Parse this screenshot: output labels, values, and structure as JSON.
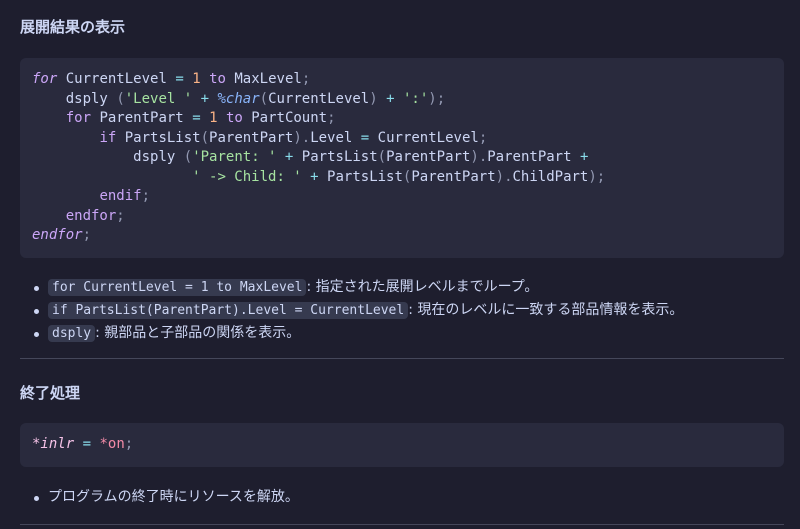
{
  "sections": {
    "display": {
      "heading": "展開結果の表示",
      "code_lines": [
        "for CurrentLevel = 1 to MaxLevel;",
        "    dsply ('Level ' + %char(CurrentLevel) + ':');",
        "    for ParentPart = 1 to PartCount;",
        "        if PartsList(ParentPart).Level = CurrentLevel;",
        "            dsply ('Parent: ' + PartsList(ParentPart).ParentPart +",
        "                   ' -> Child: ' + PartsList(ParentPart).ChildPart);",
        "        endif;",
        "    endfor;",
        "endfor;"
      ],
      "bullets": [
        {
          "code": "for CurrentLevel = 1 to MaxLevel",
          "text": ": 指定された展開レベルまでループ。"
        },
        {
          "code": "if PartsList(ParentPart).Level = CurrentLevel",
          "text": ": 現在のレベルに一致する部品情報を表示。"
        },
        {
          "code": "dsply",
          "text": ": 親部品と子部品の関係を表示。"
        }
      ]
    },
    "final": {
      "heading": "終了処理",
      "code_lines": [
        "*inlr = *on;"
      ],
      "bullets": [
        {
          "text": "プログラムの終了時にリソースを解放。"
        }
      ]
    }
  }
}
